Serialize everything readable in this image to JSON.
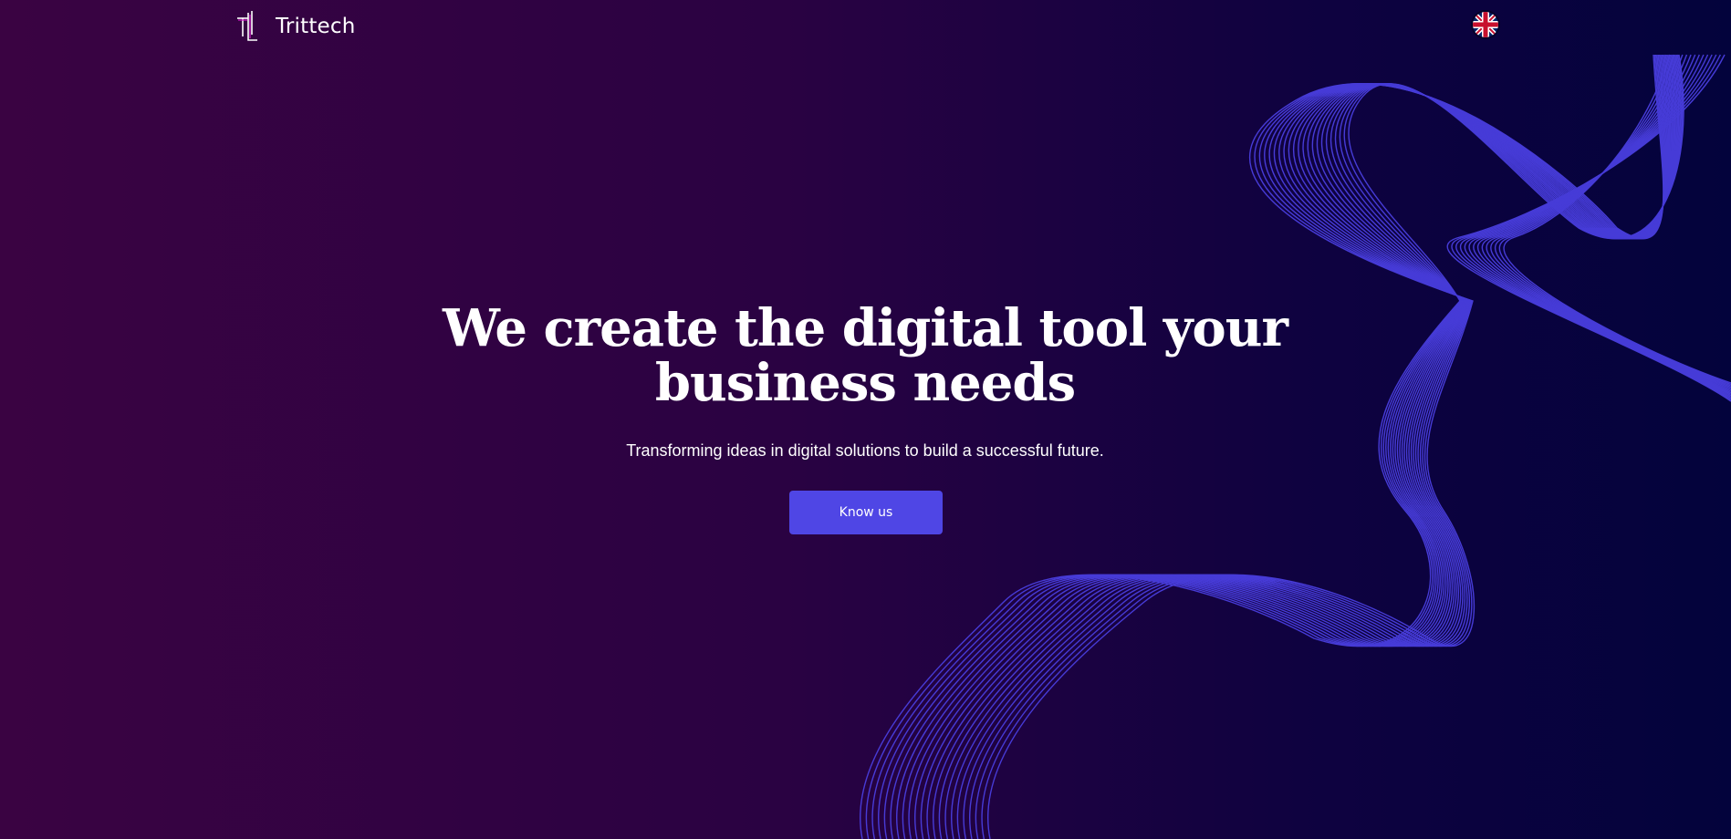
{
  "header": {
    "brand_name": "Trittech",
    "logo_icon": "trittech-logo-mark",
    "language_icon": "uk-flag-icon"
  },
  "hero": {
    "title": "We create the digital tool your business needs",
    "subtitle": "Transforming ideas in digital solutions to build a successful future.",
    "cta_label": "Know us"
  },
  "colors": {
    "background_left": "#3a0342",
    "background_right": "#03033c",
    "wave_lines": "#4a3fe0",
    "cta_background": "#4f46e5",
    "text": "#ffffff"
  }
}
